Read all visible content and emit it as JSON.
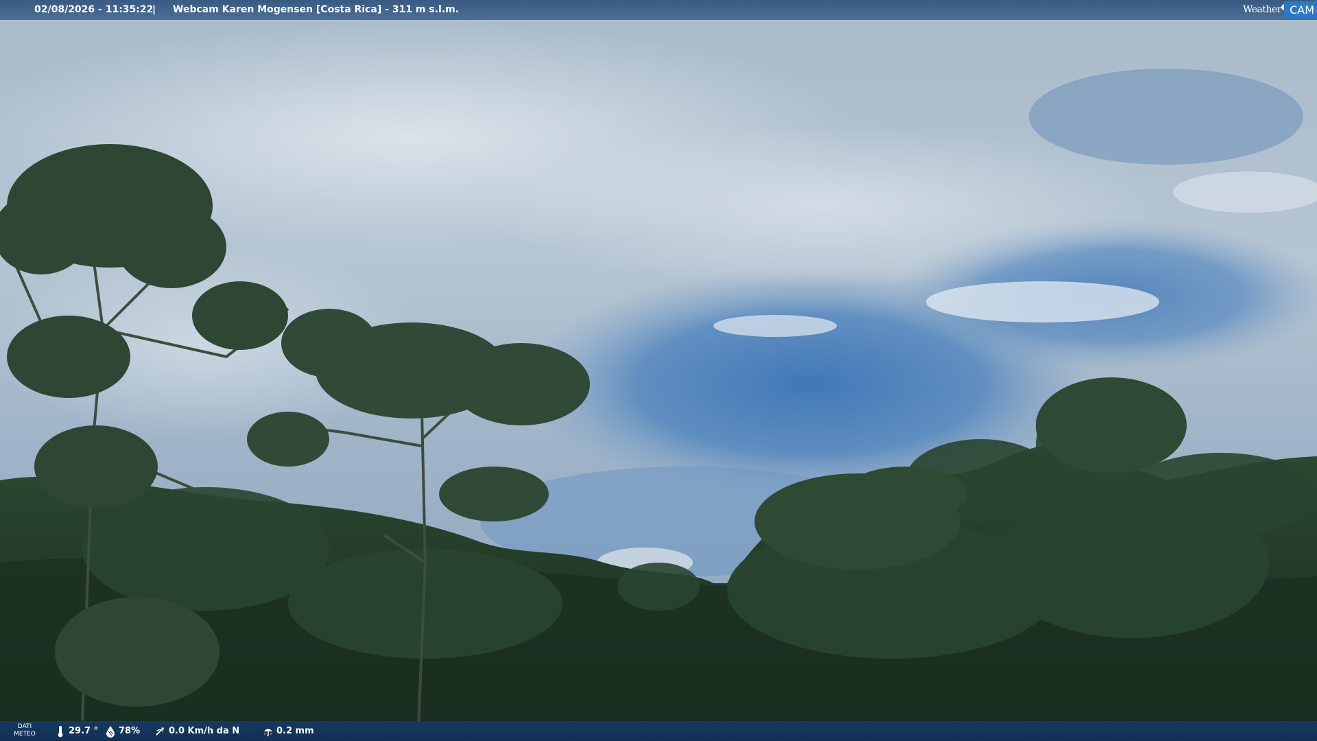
{
  "header": {
    "datetime": "02/08/2026 - 11:35:22",
    "separator": "|",
    "title": "Webcam Karen Mogensen [Costa Rica] - 311 m s.l.m.",
    "logo": {
      "word1": "Weather",
      "word2": "CAM"
    }
  },
  "footer": {
    "data_label_line1": "DATI",
    "data_label_line2": "METEO",
    "temperature": "29.7 °",
    "humidity": "78%",
    "wind": "0.0 Km/h da N",
    "rain": "0.2 mm"
  },
  "icons": {
    "temperature": "thermometer-icon",
    "humidity": "humidity-drop-icon",
    "wind": "wind-icon",
    "rain": "rain-umbrella-icon"
  },
  "colors": {
    "accent": "#2d78c4",
    "bar_top": "#34567e",
    "bar_bottom": "#163a62"
  }
}
